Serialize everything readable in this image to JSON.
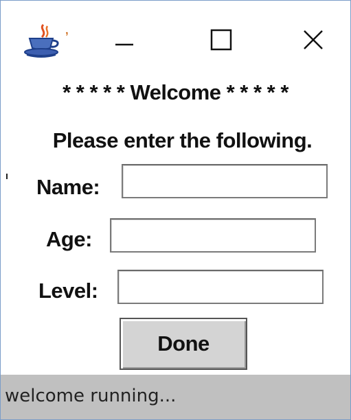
{
  "window": {
    "title": "ʼ"
  },
  "titlebar": {
    "icon": "java-coffee-cup-icon",
    "minimize_icon": "minimize-icon",
    "maximize_icon": "maximize-icon",
    "close_icon": "close-icon"
  },
  "form": {
    "welcome_text": "* * * * * Welcome * * * * *",
    "instructions_text": "Please enter the following.",
    "name_label": "Name:",
    "name_value": "",
    "age_label": "Age:",
    "age_value": "",
    "level_label": "Level:",
    "level_value": "",
    "done_label": "Done"
  },
  "status": {
    "text": "welcome running..."
  },
  "colors": {
    "window_border": "#7a9cc8",
    "status_bg": "#c0c0c0",
    "button_bg": "#d4d4d4"
  }
}
